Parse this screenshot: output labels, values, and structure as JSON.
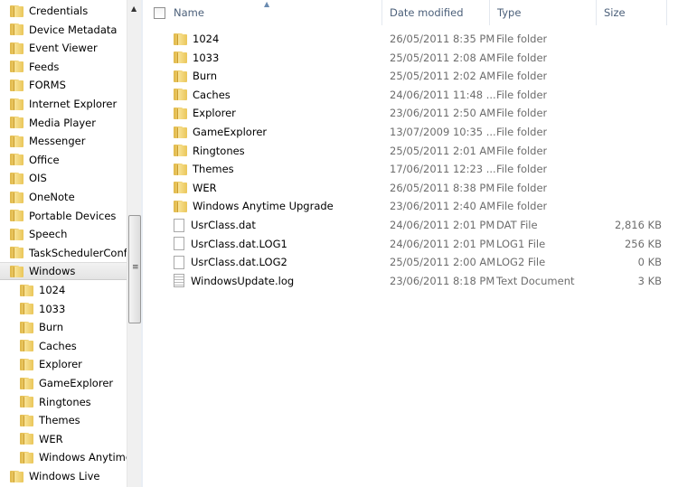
{
  "nav": {
    "items": [
      {
        "label": "Credentials",
        "level": 0
      },
      {
        "label": "Device Metadata",
        "level": 0
      },
      {
        "label": "Event Viewer",
        "level": 0
      },
      {
        "label": "Feeds",
        "level": 0
      },
      {
        "label": "FORMS",
        "level": 0
      },
      {
        "label": "Internet Explorer",
        "level": 0
      },
      {
        "label": "Media Player",
        "level": 0
      },
      {
        "label": "Messenger",
        "level": 0
      },
      {
        "label": "Office",
        "level": 0
      },
      {
        "label": "OIS",
        "level": 0
      },
      {
        "label": "OneNote",
        "level": 0
      },
      {
        "label": "Portable Devices",
        "level": 0
      },
      {
        "label": "Speech",
        "level": 0
      },
      {
        "label": "TaskSchedulerConfig",
        "level": 0
      },
      {
        "label": "Windows",
        "level": 0,
        "selected": true
      },
      {
        "label": "1024",
        "level": 1
      },
      {
        "label": "1033",
        "level": 1
      },
      {
        "label": "Burn",
        "level": 1
      },
      {
        "label": "Caches",
        "level": 1
      },
      {
        "label": "Explorer",
        "level": 1
      },
      {
        "label": "GameExplorer",
        "level": 1
      },
      {
        "label": "Ringtones",
        "level": 1
      },
      {
        "label": "Themes",
        "level": 1
      },
      {
        "label": "WER",
        "level": 1
      },
      {
        "label": "Windows Anytime Upgrade",
        "level": 1
      },
      {
        "label": "Windows Live",
        "level": 0
      }
    ]
  },
  "columns": {
    "name": "Name",
    "date": "Date modified",
    "type": "Type",
    "size": "Size"
  },
  "files": [
    {
      "name": "1024",
      "date": "26/05/2011 8:35 PM",
      "type": "File folder",
      "size": "",
      "icon": "folder"
    },
    {
      "name": "1033",
      "date": "25/05/2011 2:08 AM",
      "type": "File folder",
      "size": "",
      "icon": "folder"
    },
    {
      "name": "Burn",
      "date": "25/05/2011 2:02 AM",
      "type": "File folder",
      "size": "",
      "icon": "folder"
    },
    {
      "name": "Caches",
      "date": "24/06/2011 11:48 ...",
      "type": "File folder",
      "size": "",
      "icon": "folder"
    },
    {
      "name": "Explorer",
      "date": "23/06/2011 2:50 AM",
      "type": "File folder",
      "size": "",
      "icon": "folder"
    },
    {
      "name": "GameExplorer",
      "date": "13/07/2009 10:35 ...",
      "type": "File folder",
      "size": "",
      "icon": "folder"
    },
    {
      "name": "Ringtones",
      "date": "25/05/2011 2:01 AM",
      "type": "File folder",
      "size": "",
      "icon": "folder"
    },
    {
      "name": "Themes",
      "date": "17/06/2011 12:23 ...",
      "type": "File folder",
      "size": "",
      "icon": "folder"
    },
    {
      "name": "WER",
      "date": "26/05/2011 8:38 PM",
      "type": "File folder",
      "size": "",
      "icon": "folder"
    },
    {
      "name": "Windows Anytime Upgrade",
      "date": "23/06/2011 2:40 AM",
      "type": "File folder",
      "size": "",
      "icon": "folder"
    },
    {
      "name": "UsrClass.dat",
      "date": "24/06/2011 2:01 PM",
      "type": "DAT File",
      "size": "2,816 KB",
      "icon": "file"
    },
    {
      "name": "UsrClass.dat.LOG1",
      "date": "24/06/2011 2:01 PM",
      "type": "LOG1 File",
      "size": "256 KB",
      "icon": "file"
    },
    {
      "name": "UsrClass.dat.LOG2",
      "date": "25/05/2011 2:00 AM",
      "type": "LOG2 File",
      "size": "0 KB",
      "icon": "file"
    },
    {
      "name": "WindowsUpdate.log",
      "date": "23/06/2011 8:18 PM",
      "type": "Text Document",
      "size": "3 KB",
      "icon": "text-file"
    }
  ]
}
